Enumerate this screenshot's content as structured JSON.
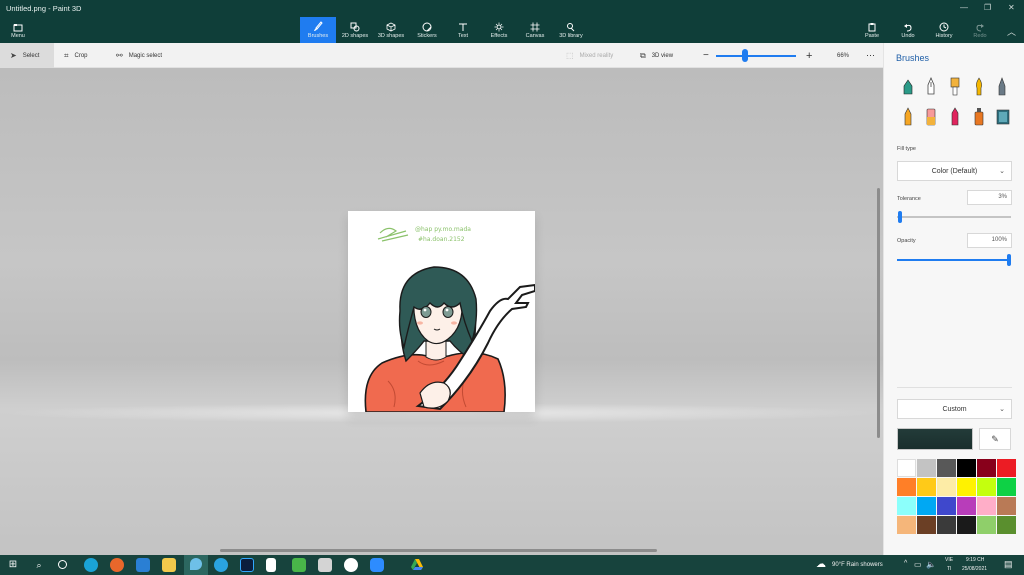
{
  "window": {
    "title": "Untitled.png - Paint 3D"
  },
  "ribbon": {
    "menu_label": "Menu",
    "tabs": [
      {
        "label": "Brushes",
        "icon": "brush-icon"
      },
      {
        "label": "2D shapes",
        "icon": "shapes-2d-icon"
      },
      {
        "label": "3D shapes",
        "icon": "cube-icon"
      },
      {
        "label": "Stickers",
        "icon": "sticker-icon"
      },
      {
        "label": "Text",
        "icon": "text-icon"
      },
      {
        "label": "Effects",
        "icon": "sun-icon"
      },
      {
        "label": "Canvas",
        "icon": "canvas-icon"
      },
      {
        "label": "3D library",
        "icon": "library-icon"
      }
    ],
    "active_tab": "Brushes",
    "right_actions": [
      {
        "label": "Paste",
        "icon": "paste-icon"
      },
      {
        "label": "Undo",
        "icon": "undo-icon"
      },
      {
        "label": "History",
        "icon": "history-icon"
      },
      {
        "label": "Redo",
        "icon": "redo-icon"
      }
    ]
  },
  "toolbar": {
    "select_label": "Select",
    "crop_label": "Crop",
    "magic_select_label": "Magic select",
    "mixed_reality_label": "Mixed reality",
    "view3d_label": "3D view",
    "zoom_percent": "66%"
  },
  "artwork": {
    "signature_line1": "@hap py.mo.mada",
    "signature_line2": "#ha.doan.2152",
    "hair_color": "#2f5a56",
    "shirt_color": "#f06a4f",
    "skin_color": "#fdf0e8"
  },
  "panel": {
    "title": "Brushes",
    "brushes": [
      "marker-icon",
      "calligraphy-pen-icon",
      "oil-brush-icon",
      "watercolor-icon",
      "pixel-pen-icon",
      "pencil-icon",
      "eraser-icon",
      "crayon-icon",
      "spray-can-icon",
      "fill-bucket-icon"
    ],
    "fill_type_label": "Fill type",
    "fill_type_value": "Color (Default)",
    "tolerance_label": "Tolerance",
    "tolerance_value": "3%",
    "tolerance_level": 0.03,
    "opacity_label": "Opacity",
    "opacity_value": "100%",
    "opacity_level": 1.0,
    "color_mode": "Custom",
    "current_color": "#233b39",
    "palette": [
      "#ffffff",
      "#c3c3c3",
      "#585858",
      "#000000",
      "#88001b",
      "#ec1c24",
      "#ff7f27",
      "#ffca18",
      "#fdeca6",
      "#fff200",
      "#c4ff0e",
      "#0ed145",
      "#8cfffb",
      "#00a8f3",
      "#3f48cc",
      "#b83dba",
      "#ffaec8",
      "#b97a56",
      "#f5b67a",
      "#6b3f25",
      "#3a3a3a",
      "#1a1a1a",
      "#8fcf6a",
      "#5a8f2e"
    ]
  },
  "taskbar": {
    "weather": "90°F  Rain showers",
    "lang_line1": "VIE",
    "lang_line2": "TI",
    "time": "9:19 CH",
    "date": "25/08/2021"
  }
}
